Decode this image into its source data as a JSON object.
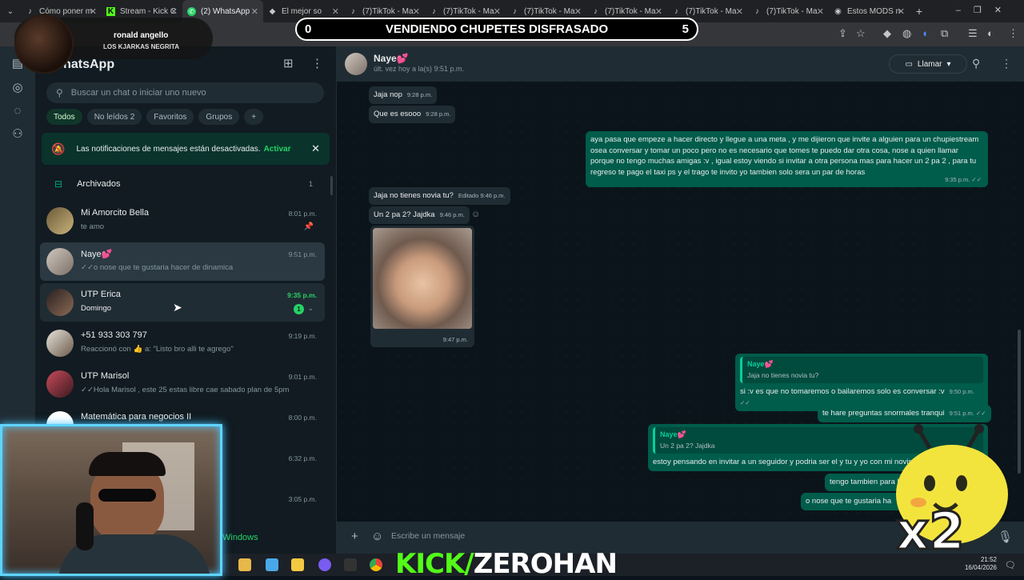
{
  "browser": {
    "tabs": [
      {
        "label": "Cómo poner m",
        "icon": "tiktok-icon",
        "active": false
      },
      {
        "label": "Stream - Kick C",
        "icon": "kick-icon",
        "active": false
      },
      {
        "label": "(2) WhatsApp",
        "icon": "whatsapp-icon",
        "active": true
      },
      {
        "label": "El mejor so",
        "icon": "diamond-icon",
        "active": false
      },
      {
        "label": "(7)TikTok - Ma",
        "icon": "tiktok-icon",
        "active": false
      },
      {
        "label": "(7)TikTok - Ma",
        "icon": "tiktok-icon",
        "active": false
      },
      {
        "label": "(7)TikTok - Ma",
        "icon": "tiktok-icon",
        "active": false
      },
      {
        "label": "(7)TikTok - Ma",
        "icon": "tiktok-icon",
        "active": false
      },
      {
        "label": "(7)TikTok - Ma",
        "icon": "tiktok-icon",
        "active": false
      },
      {
        "label": "(7)TikTok - Ma",
        "icon": "tiktok-icon",
        "active": false
      },
      {
        "label": "Estos MODS n",
        "icon": "web-icon",
        "active": false
      }
    ]
  },
  "overlay": {
    "title": "VENDIENDO CHUPETES DISFRASADO",
    "score_left": "0",
    "score_right": "5",
    "streamer_name": "ronald angello",
    "streamer_team": "LOS KJARKAS NEGRITA",
    "kick_a": "KICK/",
    "kick_b": "ZEROHAN",
    "multiplier": "x2"
  },
  "sidebar": {
    "title": "WhatsApp",
    "search_placeholder": "Buscar un chat o iniciar uno nuevo",
    "chips": [
      {
        "label": "Todos",
        "active": true
      },
      {
        "label": "No leídos 2",
        "active": false
      },
      {
        "label": "Favoritos",
        "active": false
      },
      {
        "label": "Grupos",
        "active": false
      }
    ],
    "notice": "Las notificaciones de mensajes están desactivadas.",
    "notice_action": "Activar",
    "archived_label": "Archivados",
    "archived_count": "1",
    "chats": [
      {
        "name": "Mi Amorcito Bella",
        "preview": "te amo",
        "time": "8:01 p.m."
      },
      {
        "name": "Naye💕",
        "preview": "✓✓o nose que te gustaria hacer de dinamica",
        "time": "9:51 p.m."
      },
      {
        "name": "UTP Erica",
        "preview": "Domingo",
        "time": "9:35 p.m.",
        "unread": "1"
      },
      {
        "name": "+51 933 303 797",
        "preview": "Reaccionó con 👍 a: \"Listo bro alli te agrego\"",
        "time": "9:19 p.m."
      },
      {
        "name": "UTP Marisol",
        "preview": "✓✓Hola Marisol , este 25 estas libre cae sabado plan de 5pm",
        "time": "9:01 p.m."
      },
      {
        "name": "Matemática para negocios II",
        "preview": "",
        "time": "8:00 p.m."
      },
      {
        "name": "",
        "preview": "",
        "time": "6:32 p.m."
      },
      {
        "name": "",
        "preview": "",
        "time": "3:05 p.m."
      }
    ],
    "footer_hint": "Windows"
  },
  "conversation": {
    "name": "Naye💕",
    "status": "últ. vez hoy a la(s) 9:51 p.m.",
    "call_label": "Llamar",
    "composer_placeholder": "Escribe un mensaje",
    "messages": {
      "m1": {
        "text": "Jaja nop",
        "time": "9:28 p.m."
      },
      "m2": {
        "text": "Que es esooo",
        "time": "9:28 p.m."
      },
      "m3": {
        "text": "aya pasa que empeze a hacer directo y llegue a una meta , y me dijieron que invite a alguien para un chupiestream osea conversar y tomar un poco pero no es necesario que tomes te puedo dar otra cosa, nose a quien llamar porque no tengo muchas amigas :v , igual estoy viendo si invitar a otra persona mas para hacer un 2 pa 2 , para tu regreso te pago el taxi ps y el trago te invito yo tambien solo sera un par de horas",
        "time": "9:35 p.m. ✓✓"
      },
      "m4": {
        "text": "Jaja no tienes novia tu?",
        "time": "Editado 9:46 p.m."
      },
      "m5": {
        "text": "Un 2 pa 2? Jajdka",
        "time": "9:46 p.m."
      },
      "m6": {
        "time": "9:47 p.m."
      },
      "m7": {
        "quote_name": "Naye💕",
        "quote_text": "Jaja no tienes novia tu?",
        "text": "si :v es que no tomaremos o bailaremos solo es conversar :v",
        "time": "9:50 p.m. ✓✓"
      },
      "m8": {
        "text": "te hare preguntas snormales tranqui",
        "time": "9:51 p.m. ✓✓"
      },
      "m9": {
        "quote_name": "Naye💕",
        "quote_text": "Un 2 pa 2? Jajdka",
        "text": "estoy pensando en invitar a un seguidor y podria ser el y tu y yo con mi novis"
      },
      "m10": {
        "text": "tengo tambien para h"
      },
      "m11": {
        "text": "o nose que te gustaria ha"
      }
    }
  },
  "taskbar": {
    "time": "21:52",
    "date": "16/04/2026"
  },
  "colors": {
    "accent": "#00a884",
    "outgoing_bubble": "#005c4b",
    "incoming_bubble": "#202c33",
    "kick_green": "#53fc18"
  }
}
